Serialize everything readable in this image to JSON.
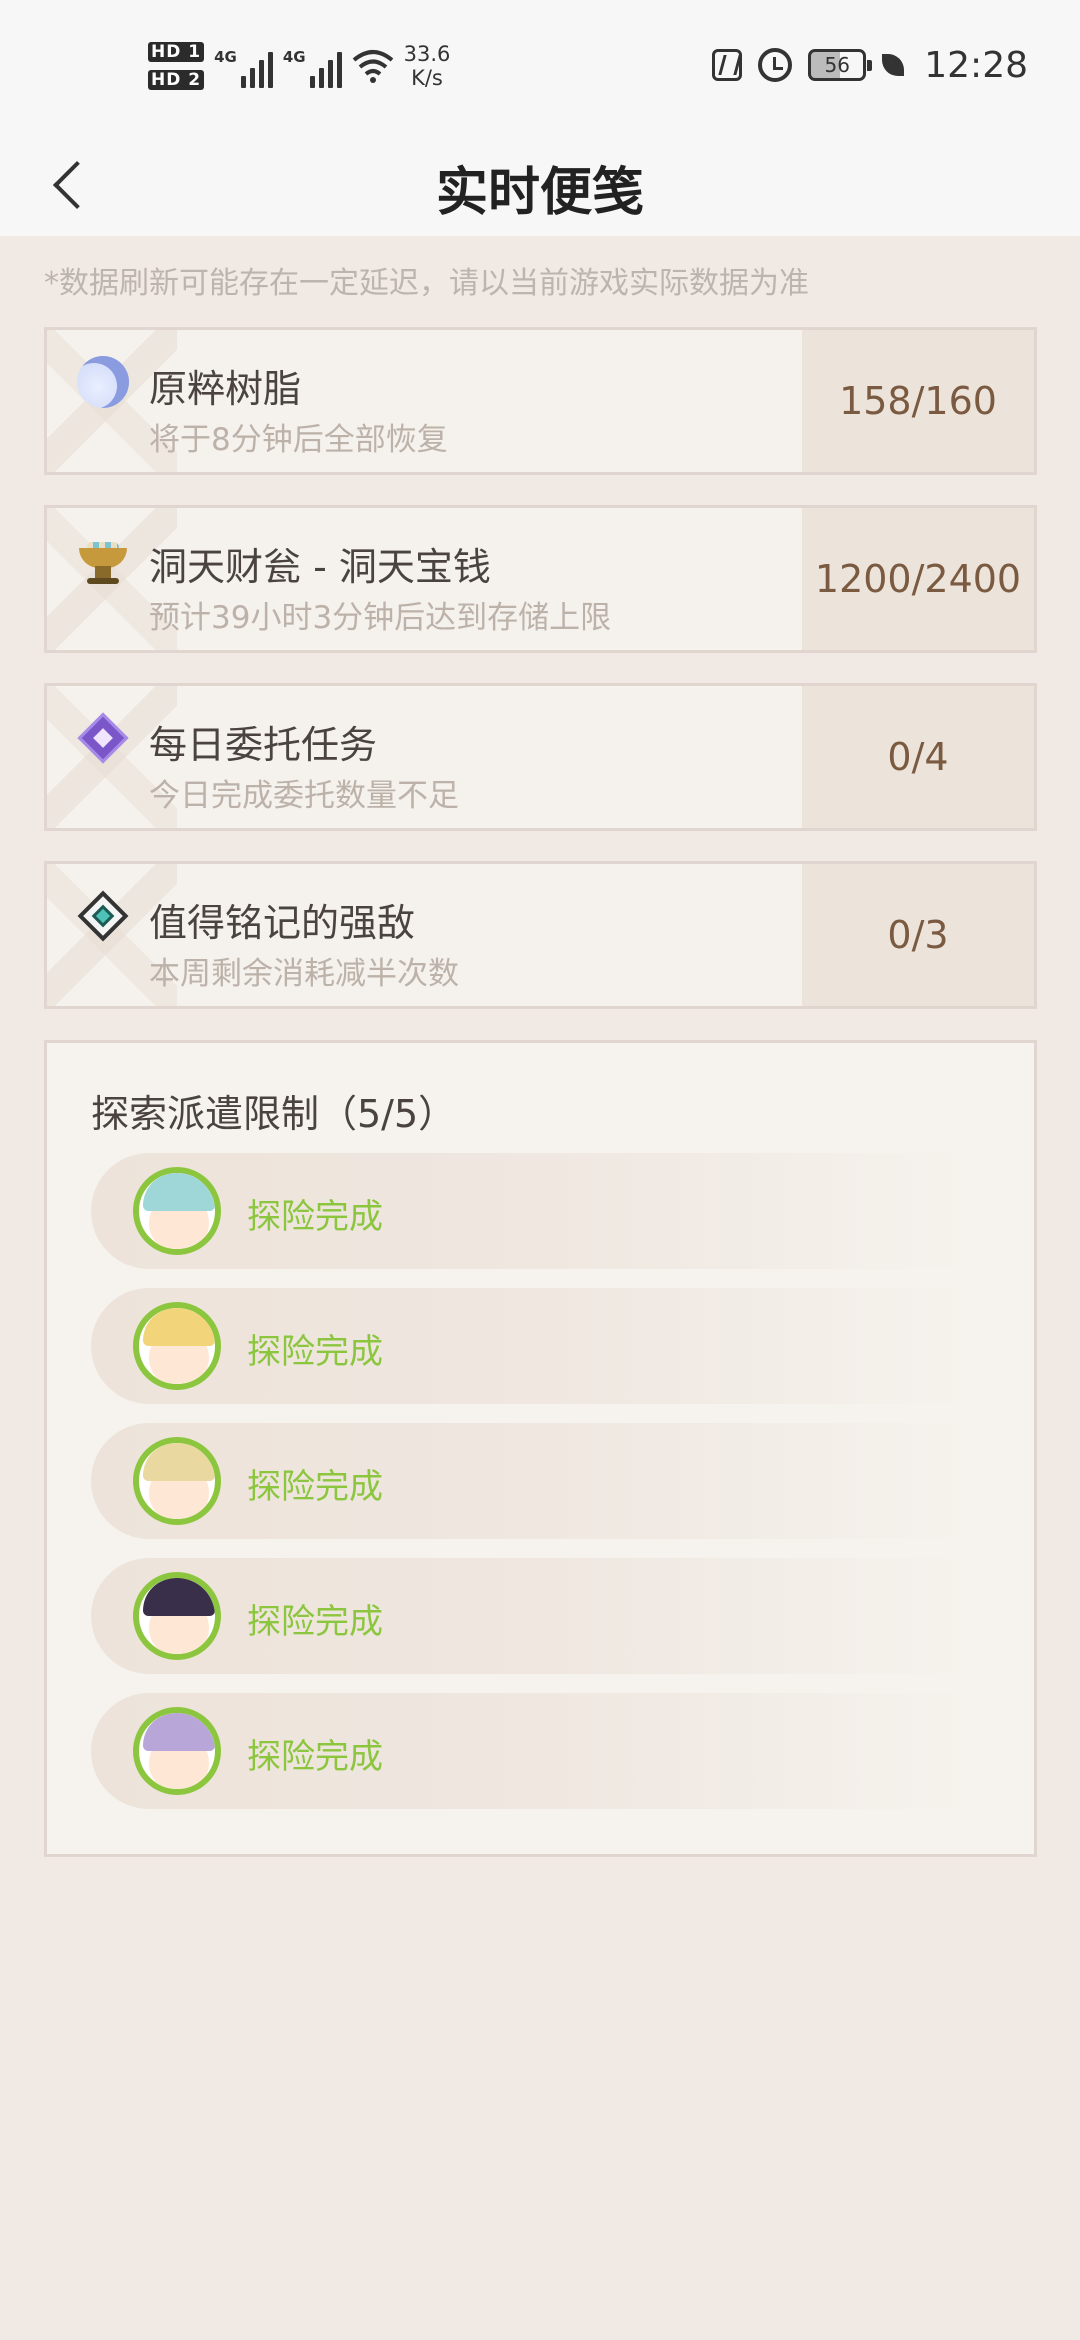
{
  "status_bar": {
    "hd1": "HD 1",
    "hd2": "HD 2",
    "net1": "4G",
    "net2": "4G",
    "speed_value": "33.6",
    "speed_unit": "K/s",
    "battery": "56",
    "time": "12:28"
  },
  "header": {
    "title": "实时便笺"
  },
  "notice": "*数据刷新可能存在一定延迟，请以当前游戏实际数据为准",
  "cards": [
    {
      "icon": "resin-moon-icon",
      "name": "原粹树脂",
      "desc": "将于8分钟后全部恢复",
      "value": "158/160"
    },
    {
      "icon": "realm-currency-icon",
      "name": "洞天财瓮 - 洞天宝钱",
      "desc": "预计39小时3分钟后达到存储上限",
      "value": "1200/2400"
    },
    {
      "icon": "daily-commission-icon",
      "name": "每日委托任务",
      "desc": "今日完成委托数量不足",
      "value": "0/4"
    },
    {
      "icon": "weekly-boss-icon",
      "name": "值得铭记的强敌",
      "desc": "本周剩余消耗减半次数",
      "value": "0/3"
    }
  ],
  "expedition": {
    "title": "探索派遣限制（5/5）",
    "items": [
      {
        "status": "探险完成",
        "hair": "#9fd6d8"
      },
      {
        "status": "探险完成",
        "hair": "#f2d57a"
      },
      {
        "status": "探险完成",
        "hair": "#e9d9a0"
      },
      {
        "status": "探险完成",
        "hair": "#3a2f4a"
      },
      {
        "status": "探险完成",
        "hair": "#b8a6d8"
      }
    ]
  },
  "colors": {
    "background": "#f1e9e4",
    "accent_green": "#8cc63f",
    "value_text": "#7a5a40"
  }
}
